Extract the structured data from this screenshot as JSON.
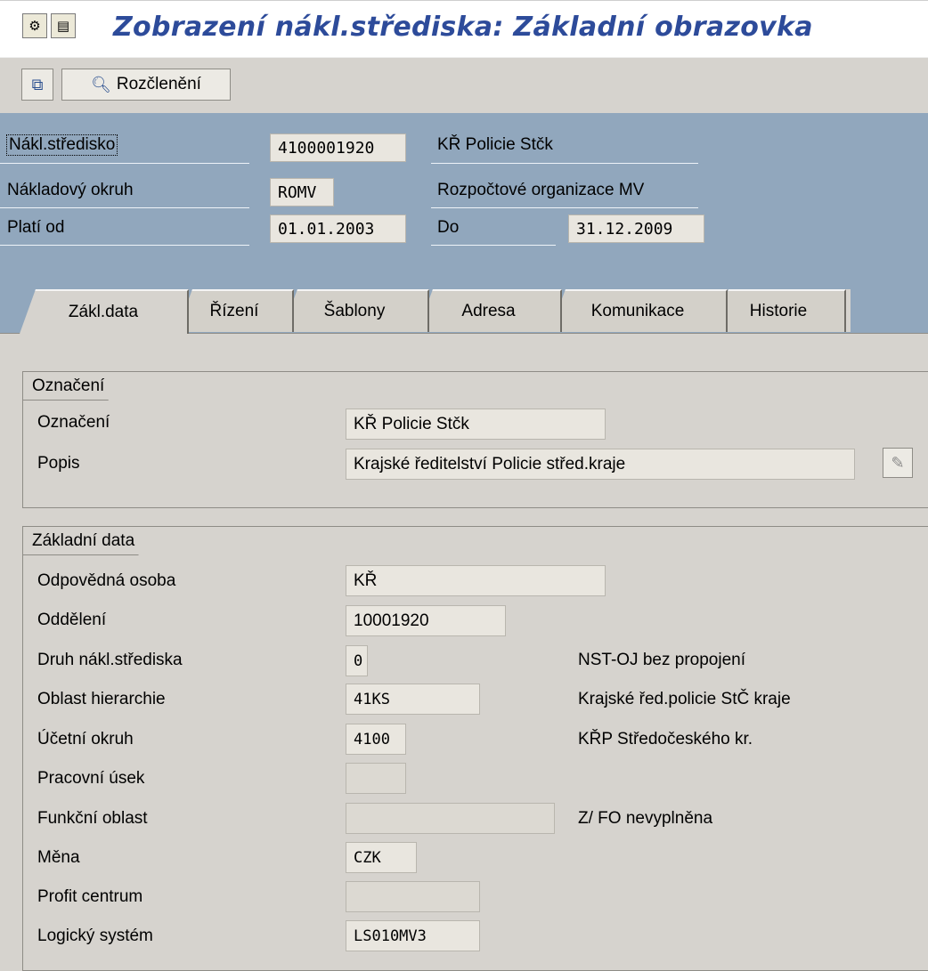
{
  "window": {
    "title": "Zobrazení nákl.střediska: Základní obrazovka",
    "title_icons": [
      "text-template-icon",
      "document-icon"
    ]
  },
  "toolbar": {
    "other_object_icon": "object-switch-icon",
    "breakdown_icon": "magnifier-icon",
    "breakdown_label": "Rozčlenění"
  },
  "header": {
    "cost_center_label": "Nákl.středisko",
    "cost_center_value": "4100001920",
    "cost_center_text": "KŘ Policie Stčk",
    "controlling_area_label": "Nákladový okruh",
    "controlling_area_value": "ROMV",
    "controlling_area_text": "Rozpočtové organizace MV",
    "valid_from_label": "Platí od",
    "valid_from_value": "01.01.2003",
    "valid_to_label": "Do",
    "valid_to_value": "31.12.2009"
  },
  "tabs": [
    {
      "label": "Zákl.data",
      "active": true
    },
    {
      "label": "Řízení",
      "active": false
    },
    {
      "label": "Šablony",
      "active": false
    },
    {
      "label": "Adresa",
      "active": false
    },
    {
      "label": "Komunikace",
      "active": false
    },
    {
      "label": "Historie",
      "active": false
    }
  ],
  "designation_group": {
    "title": "Označení",
    "name_label": "Označení",
    "name_value": "KŘ Policie Stčk",
    "description_label": "Popis",
    "description_value": "Krajské ředitelství Policie střed.kraje",
    "edit_icon": "pencil-edit-icon"
  },
  "basic_data_group": {
    "title": "Základní data",
    "fields": [
      {
        "label": "Odpovědná osoba",
        "value": "KŘ",
        "text": ""
      },
      {
        "label": "Oddělení",
        "value": "10001920",
        "text": ""
      },
      {
        "label": "Druh nákl.střediska",
        "value": "0",
        "text": "NST-OJ bez propojení"
      },
      {
        "label": "Oblast hierarchie",
        "value": "41KS",
        "text": "Krajské řed.policie StČ kraje"
      },
      {
        "label": "Účetní okruh",
        "value": "4100",
        "text": "KŘP Středočeského kr."
      },
      {
        "label": "Pracovní úsek",
        "value": "",
        "text": ""
      },
      {
        "label": "Funkční oblast",
        "value": "",
        "text": "Z/ FO nevyplněna"
      },
      {
        "label": "Měna",
        "value": "CZK",
        "text": ""
      },
      {
        "label": "Profit centrum",
        "value": "",
        "text": ""
      },
      {
        "label": "Logický systém",
        "value": "LS010MV3",
        "text": ""
      }
    ]
  }
}
